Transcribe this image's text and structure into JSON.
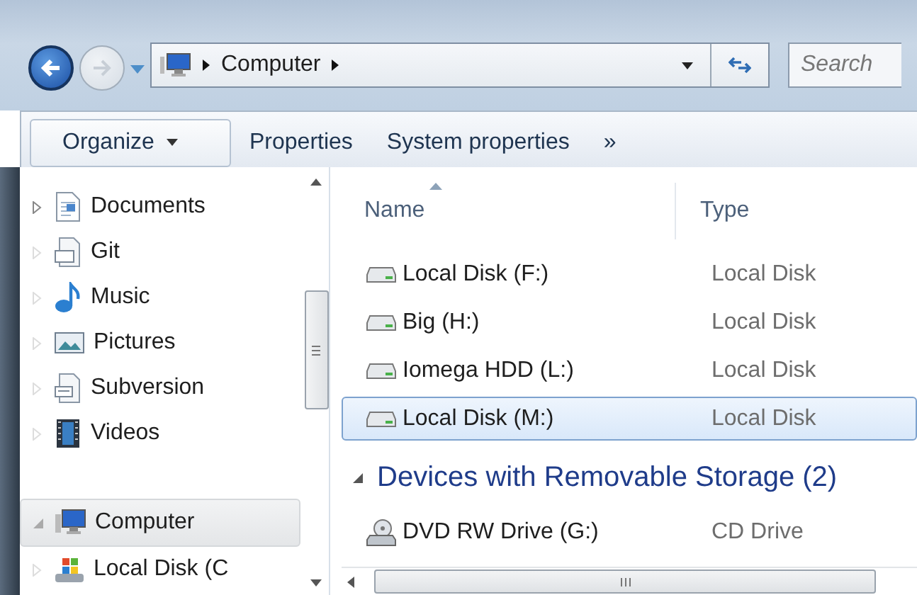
{
  "nav": {
    "back_disabled": false,
    "forward_disabled": true
  },
  "address": {
    "crumbs": [
      "Computer"
    ]
  },
  "search": {
    "placeholder": "Search"
  },
  "toolbar": [
    {
      "label": "Organize",
      "dropdown": true
    },
    {
      "label": "Properties",
      "dropdown": false
    },
    {
      "label": "System properties",
      "dropdown": false
    },
    {
      "label": "»",
      "dropdown": false
    }
  ],
  "sidebar": {
    "items": [
      {
        "label": "Documents",
        "kind": "documents",
        "expanded": false,
        "selected": false
      },
      {
        "label": "Git",
        "kind": "git",
        "expanded": false,
        "selected": false
      },
      {
        "label": "Music",
        "kind": "music",
        "expanded": false,
        "selected": false
      },
      {
        "label": "Pictures",
        "kind": "pictures",
        "expanded": false,
        "selected": false
      },
      {
        "label": "Subversion",
        "kind": "folder",
        "expanded": false,
        "selected": false
      },
      {
        "label": "Videos",
        "kind": "videos",
        "expanded": false,
        "selected": false
      },
      {
        "label": "Computer",
        "kind": "computer",
        "expanded": true,
        "selected": true
      },
      {
        "label": "Local Disk (C",
        "kind": "drive",
        "expanded": false,
        "selected": false
      }
    ]
  },
  "columns": [
    {
      "label": "Name",
      "sorted": true
    },
    {
      "label": "Type",
      "sorted": false
    }
  ],
  "groups": [
    {
      "rows": [
        {
          "name": "Local Disk (F:)",
          "type": "Local Disk",
          "kind": "disk",
          "selected": false
        },
        {
          "name": "Big (H:)",
          "type": "Local Disk",
          "kind": "disk",
          "selected": false
        },
        {
          "name": "Iomega HDD (L:)",
          "type": "Local Disk",
          "kind": "disk",
          "selected": false
        },
        {
          "name": "Local Disk (M:)",
          "type": "Local Disk",
          "kind": "disk",
          "selected": true
        }
      ]
    },
    {
      "title": "Devices with Removable Storage (2)",
      "expanded": true,
      "rows": [
        {
          "name": "DVD RW Drive (G:)",
          "type": "CD Drive",
          "kind": "dvd",
          "selected": false
        }
      ]
    }
  ]
}
